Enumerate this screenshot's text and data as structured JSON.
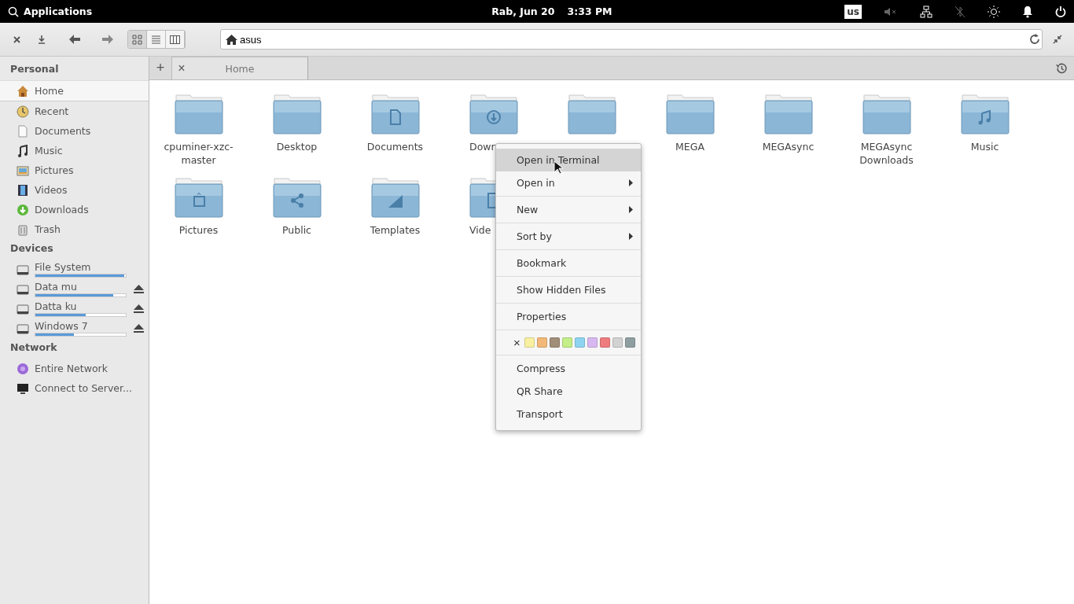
{
  "panel": {
    "applications": "Applications",
    "date": "Rab, Jun 20",
    "time": "3:33 PM",
    "keyboard": "us"
  },
  "toolbar": {
    "views": [
      {
        "kind": "icons",
        "selected": true
      },
      {
        "kind": "list",
        "selected": false
      },
      {
        "kind": "columns",
        "selected": false
      }
    ],
    "breadcrumb": "asus"
  },
  "tabs": [
    {
      "label": "Home",
      "close": "×"
    }
  ],
  "tab_add": "+",
  "sidebar": [
    {
      "heading": "Personal",
      "items": [
        {
          "label": "Home",
          "kind": "home",
          "selected": true
        },
        {
          "label": "Recent",
          "kind": "recent",
          "selected": false
        },
        {
          "label": "Documents",
          "kind": "document",
          "selected": false
        },
        {
          "label": "Music",
          "kind": "music",
          "selected": false
        },
        {
          "label": "Pictures",
          "kind": "pictures",
          "selected": false
        },
        {
          "label": "Videos",
          "kind": "videos",
          "selected": false
        },
        {
          "label": "Downloads",
          "kind": "downloads",
          "selected": false
        },
        {
          "label": "Trash",
          "kind": "trash",
          "selected": false
        }
      ]
    },
    {
      "heading": "Devices",
      "items": [
        {
          "label": "File System",
          "kind": "drive",
          "selected": false,
          "level": 0.98,
          "ejectable": false
        },
        {
          "label": "Data mu",
          "kind": "drive",
          "selected": false,
          "level": 0.86,
          "ejectable": true
        },
        {
          "label": "Datta ku",
          "kind": "drive",
          "selected": false,
          "level": 0.56,
          "ejectable": true
        },
        {
          "label": "Windows 7",
          "kind": "drive",
          "selected": false,
          "level": 0.43,
          "ejectable": true
        }
      ]
    },
    {
      "heading": "Network",
      "items": [
        {
          "label": "Entire Network",
          "kind": "network",
          "selected": false
        },
        {
          "label": "Connect to Server...",
          "kind": "monitor",
          "selected": false
        }
      ]
    }
  ],
  "folders": [
    {
      "name": "cpuminer-xzc-master",
      "kind": "plain"
    },
    {
      "name": "Desktop",
      "kind": "plain"
    },
    {
      "name": "Documents",
      "kind": "document"
    },
    {
      "name": "Down",
      "kind": "download",
      "covered": true
    },
    {
      "kind": "plain"
    },
    {
      "name": "MEGA",
      "kind": "plain"
    },
    {
      "name": "MEGAsync",
      "kind": "plain"
    },
    {
      "name": "MEGAsync Downloads",
      "kind": "plain"
    },
    {
      "name": "Music",
      "kind": "music"
    },
    {
      "name": "Pictures",
      "kind": "picture"
    },
    {
      "name": "Public",
      "kind": "share"
    },
    {
      "name": "Templates",
      "kind": "templates"
    },
    {
      "name": "Vide",
      "kind": "video",
      "covered": true
    }
  ],
  "context_menu": {
    "groups": [
      [
        {
          "kind": "item",
          "label": "Open in Terminal",
          "selected": true
        },
        {
          "kind": "submenu",
          "label": "Open in",
          "selected": false
        }
      ],
      [
        {
          "kind": "submenu",
          "label": "New",
          "selected": false
        }
      ],
      [
        {
          "kind": "submenu",
          "label": "Sort by",
          "selected": false
        }
      ],
      [
        {
          "kind": "item",
          "label": "Bookmark",
          "selected": false
        }
      ],
      [
        {
          "kind": "item",
          "label": "Show Hidden Files",
          "selected": false
        }
      ],
      [
        {
          "kind": "item",
          "label": "Properties",
          "selected": false
        }
      ],
      [
        {
          "kind": "colors",
          "clear": "×",
          "swatches": [
            {
              "color": "#f8f0a0"
            },
            {
              "color": "#f2b878"
            },
            {
              "color": "#a08e78"
            },
            {
              "color": "#c4ee88"
            },
            {
              "color": "#8ed4f0"
            },
            {
              "color": "#d8b8f0"
            },
            {
              "color": "#ee7c7e"
            },
            {
              "color": "#d2d2d2"
            },
            {
              "color": "#8f9ea0"
            }
          ]
        }
      ],
      [
        {
          "kind": "item",
          "label": "Compress",
          "selected": false
        },
        {
          "kind": "item",
          "label": "QR Share",
          "selected": false
        },
        {
          "kind": "item",
          "label": "Transport",
          "selected": false
        }
      ]
    ]
  }
}
